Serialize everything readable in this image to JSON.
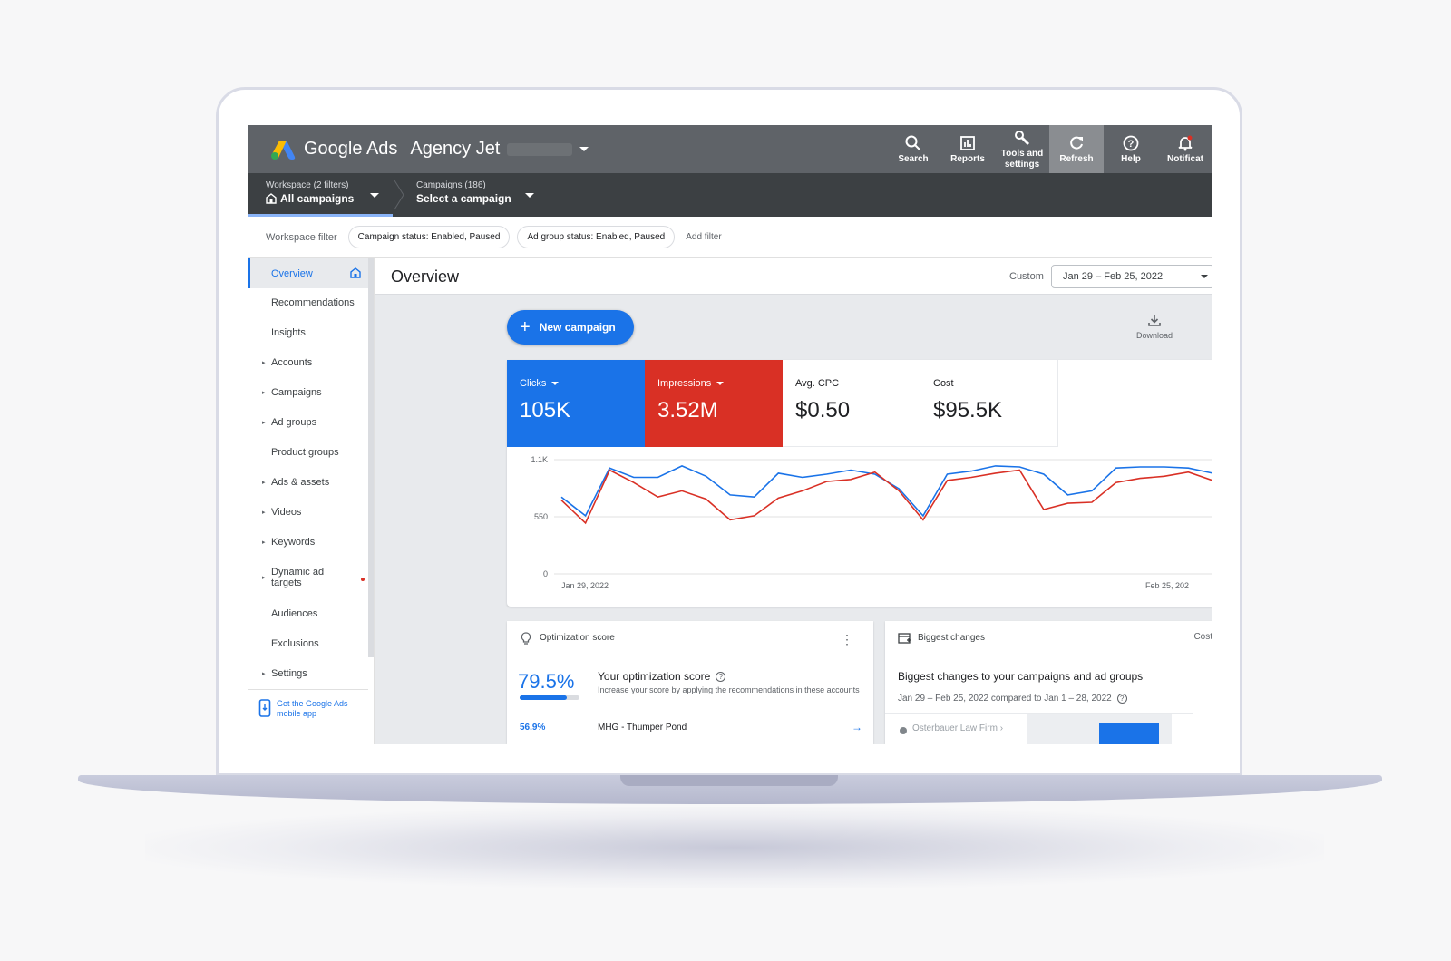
{
  "header": {
    "brand": "Google Ads",
    "account": "Agency Jet",
    "tools": [
      {
        "label": "Search",
        "icon": "search-icon"
      },
      {
        "label": "Reports",
        "icon": "reports-icon"
      },
      {
        "label": "Tools and settings",
        "icon": "wrench-icon"
      },
      {
        "label": "Refresh",
        "icon": "refresh-icon"
      },
      {
        "label": "Help",
        "icon": "help-icon"
      },
      {
        "label": "Notificat",
        "icon": "bell-icon"
      }
    ]
  },
  "subbar": {
    "workspace_small": "Workspace (2 filters)",
    "workspace_big": "All campaigns",
    "campaigns_small": "Campaigns (186)",
    "campaigns_big": "Select a campaign"
  },
  "filters": {
    "label": "Workspace filter",
    "chips": [
      "Campaign status: Enabled, Paused",
      "Ad group status: Enabled, Paused"
    ],
    "add": "Add filter"
  },
  "sidebar": {
    "items": [
      {
        "label": "Overview",
        "active": true
      },
      {
        "label": "Recommendations"
      },
      {
        "label": "Insights"
      },
      {
        "label": "Accounts",
        "expandable": true
      },
      {
        "label": "Campaigns",
        "expandable": true
      },
      {
        "label": "Ad groups",
        "expandable": true
      },
      {
        "label": "Product groups"
      },
      {
        "label": "Ads & assets",
        "expandable": true
      },
      {
        "label": "Videos",
        "expandable": true
      },
      {
        "label": "Keywords",
        "expandable": true
      },
      {
        "label": "Dynamic ad targets",
        "expandable": true,
        "dot": true
      },
      {
        "label": "Audiences"
      },
      {
        "label": "Exclusions"
      },
      {
        "label": "Settings",
        "expandable": true
      }
    ],
    "mobile_app": "Get the Google Ads mobile app"
  },
  "main": {
    "title": "Overview",
    "date_label": "Custom",
    "date_range": "Jan 29 – Feb 25, 2022",
    "new_campaign": "New campaign",
    "download": "Download",
    "metrics": [
      {
        "label": "Clicks",
        "value": "105K",
        "color": "#1a73e8"
      },
      {
        "label": "Impressions",
        "value": "3.52M",
        "color": "#d93025"
      },
      {
        "label": "Avg. CPC",
        "value": "$0.50"
      },
      {
        "label": "Cost",
        "value": "$95.5K"
      }
    ]
  },
  "chart_data": {
    "type": "line",
    "x_start_label": "Jan 29, 2022",
    "x_end_label": "Feb 25, 202",
    "y_ticks": [
      "1.1K",
      "550",
      "0"
    ],
    "ylim": [
      0,
      1100
    ],
    "series": [
      {
        "color": "#1a73e8",
        "values": [
          740,
          560,
          1020,
          930,
          930,
          1040,
          940,
          760,
          740,
          970,
          930,
          960,
          1000,
          960,
          820,
          560,
          960,
          990,
          1040,
          1030,
          960,
          760,
          800,
          1020,
          1030,
          1030,
          1020,
          970
        ]
      },
      {
        "color": "#d93025",
        "values": [
          710,
          490,
          1000,
          880,
          740,
          800,
          720,
          520,
          560,
          730,
          800,
          890,
          910,
          980,
          800,
          520,
          900,
          930,
          970,
          1000,
          620,
          680,
          690,
          880,
          920,
          940,
          980,
          900
        ]
      }
    ]
  },
  "optimization": {
    "header": "Optimization score",
    "score": "79.5%",
    "score_fraction": 0.795,
    "title": "Your optimization score",
    "desc": "Increase your score by applying the recommendations in these accounts",
    "row_score": "56.9%",
    "row_name": "MHG - Thumper Pond"
  },
  "biggest_changes": {
    "header": "Biggest changes",
    "cost_label": "Cost",
    "title": "Biggest changes to your campaigns and ad groups",
    "subtitle": "Jan 29 – Feb 25, 2022 compared to Jan 1 – 28, 2022",
    "row_name": "Osterbauer Law Firm ›"
  }
}
